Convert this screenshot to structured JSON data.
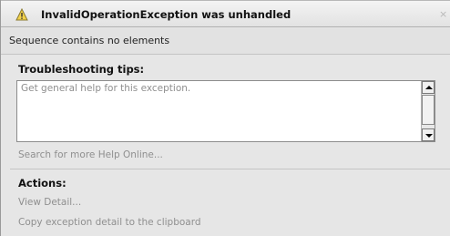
{
  "dialog": {
    "title": "InvalidOperationException was unhandled",
    "close_glyph": "×",
    "icon": "warning-icon",
    "message": "Sequence contains no elements"
  },
  "troubleshooting": {
    "title": "Troubleshooting tips:",
    "tip": "Get general help for this exception.",
    "search_link": "Search for more Help Online..."
  },
  "actions": {
    "title": "Actions:",
    "view_detail": "View Detail...",
    "copy_detail": "Copy exception detail to the clipboard"
  },
  "colors": {
    "background": "#e6e6e6",
    "link_text": "#8f8f8f"
  }
}
